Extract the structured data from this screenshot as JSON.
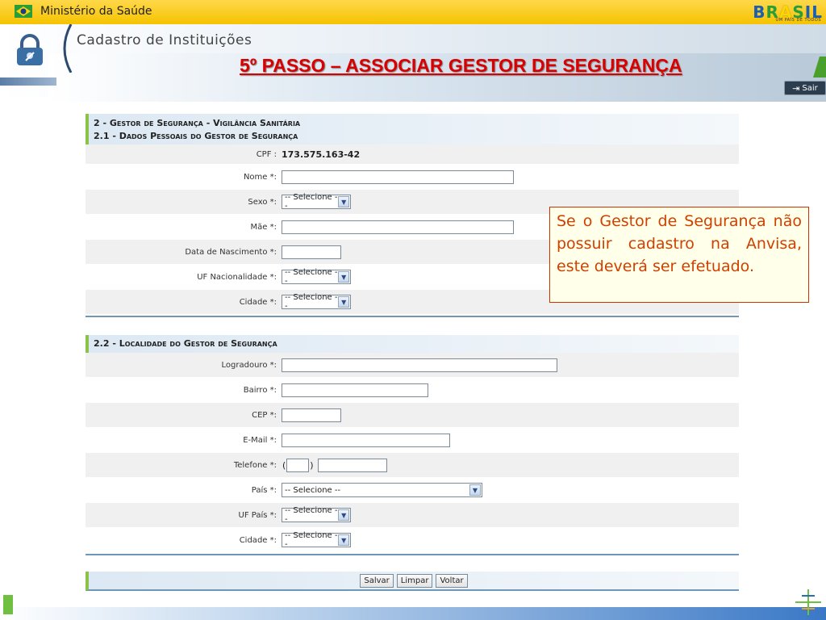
{
  "header": {
    "ministry": "Ministério da Saúde",
    "system_title": "Cadastro de Instituições",
    "step_title": "5º PASSO – ASSOCIAR GESTOR DE SEGURANÇA",
    "logout_label": "Sair",
    "brand_logo_text": "BRASIL",
    "brand_logo_sub": "UM PAÍS DE TODOS"
  },
  "section1": {
    "title": "2 - Gestor de Segurança - Vigilância Sanitária",
    "subtitle": "2.1 - Dados Pessoais do Gestor de Segurança",
    "cpf_label": "CPF :",
    "cpf_value": "173.575.163-42",
    "nome_label": "Nome *:",
    "sexo_label": "Sexo *:",
    "sexo_value": "-- Selecione --",
    "mae_label": "Mãe *:",
    "nascimento_label": "Data de Nascimento *:",
    "uf_label": "UF Nacionalidade *:",
    "uf_value": "-- Selecione --",
    "cidade_label": "Cidade *:",
    "cidade_value": "-- Selecione --"
  },
  "section2": {
    "title": "2.2 - Localidade do Gestor de Segurança",
    "logradouro_label": "Logradouro *:",
    "bairro_label": "Bairro *:",
    "cep_label": "CEP *:",
    "email_label": "E-Mail *:",
    "telefone_label": "Telefone *:",
    "tel_open": "(",
    "tel_close": ")",
    "pais_label": "País *:",
    "pais_value": "-- Selecione --",
    "ufpais_label": "UF País *:",
    "ufpais_value": "-- Selecione --",
    "cidade_label": "Cidade *:",
    "cidade_value": "-- Selecione --"
  },
  "buttons": {
    "salvar": "Salvar",
    "limpar": "Limpar",
    "voltar": "Voltar"
  },
  "callout": {
    "text": "Se o Gestor de Segurança não possuir cadastro na Anvisa, este deverá ser efetuado."
  },
  "colors": {
    "step_title": "#d80000",
    "callout_text": "#d04000",
    "topbar": "#f5c300",
    "section_accent": "#8bc34a"
  }
}
